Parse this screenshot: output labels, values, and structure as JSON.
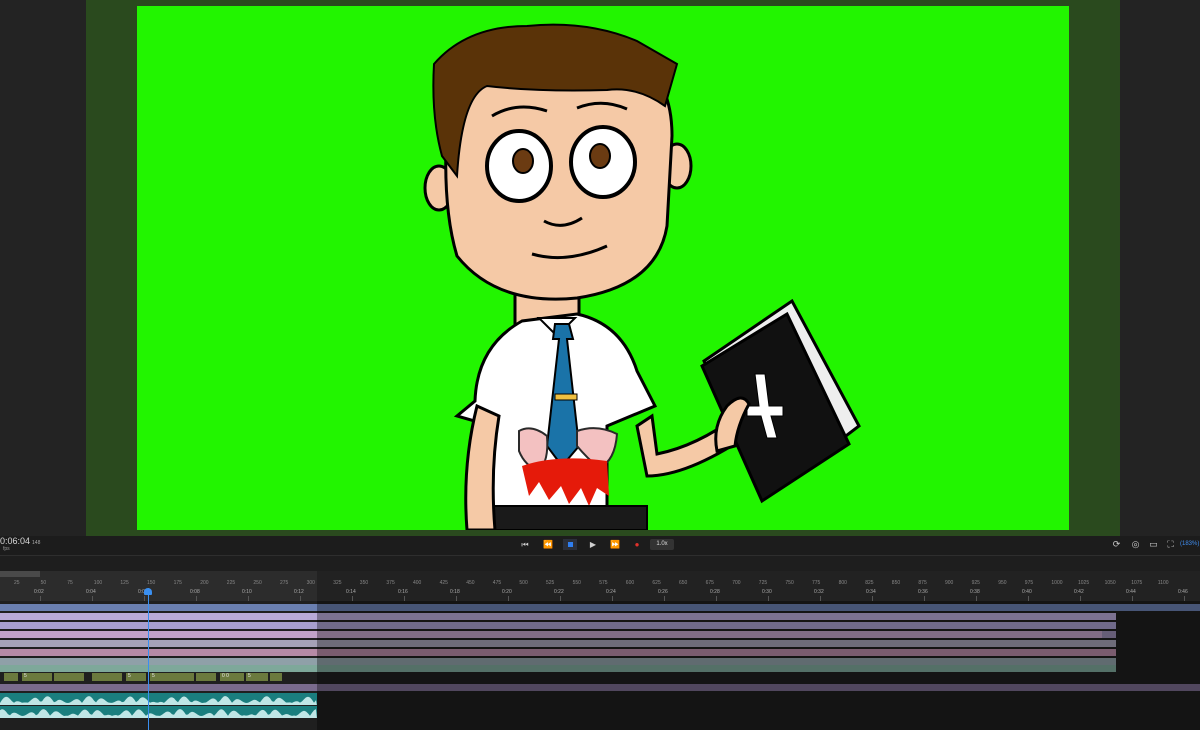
{
  "transport": {
    "timecode": "0:06:04",
    "timecode_sub": "148",
    "fps_label": "fps",
    "speed": "1.0x",
    "zoom": "(183%)",
    "buttons": [
      "skip-start",
      "step-back",
      "stop",
      "play",
      "step-forward",
      "record"
    ]
  },
  "ruler": {
    "frames": [
      "25",
      "50",
      "75",
      "100",
      "125",
      "150",
      "175",
      "200",
      "225",
      "250",
      "275",
      "300",
      "325",
      "350",
      "375",
      "400",
      "425",
      "450",
      "475",
      "500",
      "525",
      "550",
      "575",
      "600",
      "625",
      "650",
      "675",
      "700",
      "725",
      "750",
      "775",
      "800",
      "825",
      "850",
      "875",
      "900",
      "925",
      "950",
      "975",
      "1000",
      "1025",
      "1050",
      "1075",
      "1100"
    ],
    "times": [
      "0:02",
      "0:04",
      "0:06",
      "0:08",
      "0:10",
      "0:12",
      "0:14",
      "0:16",
      "0:18",
      "0:20",
      "0:22",
      "0:24",
      "0:26",
      "0:28",
      "0:30",
      "0:32",
      "0:34",
      "0:36",
      "0:38",
      "0:40",
      "0:42",
      "0:44",
      "0:46"
    ]
  },
  "tracks": {
    "colors": [
      "#6a7fb0",
      "#b9aad8",
      "#a89fd0",
      "#c1a2c8",
      "#a5a2b7",
      "#b68aa6",
      "#8fa0a8",
      "#7ea89a",
      "#6b7a3e",
      "#7a6b8d",
      "#1a7e7e"
    ],
    "cell_labels": [
      "5",
      "5",
      "5",
      "0 0",
      "5"
    ]
  },
  "colors": {
    "accent": "#3a8ff0",
    "stage_bg": "#22f500"
  }
}
